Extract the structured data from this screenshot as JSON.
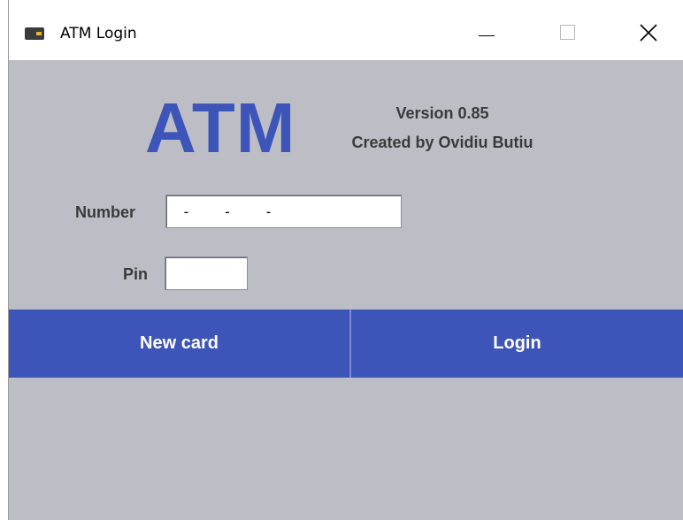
{
  "window": {
    "title": "ATM Login",
    "app_icon": "atm-card-icon",
    "controls": {
      "minimize_icon": "minimize-icon",
      "maximize_icon": "maximize-icon",
      "close_icon": "close-icon"
    }
  },
  "header": {
    "logo": "ATM",
    "version": "Version 0.85",
    "creator": "Created by Ovidiu Butiu"
  },
  "form": {
    "number_label": "Number",
    "number_value": " -   -   -",
    "pin_label": "Pin",
    "pin_value": ""
  },
  "buttons": {
    "new_card": "New card",
    "login": "Login"
  },
  "colors": {
    "accent": "#3d55b8",
    "background": "#bdbdc6",
    "text": "#3a3a3a"
  }
}
